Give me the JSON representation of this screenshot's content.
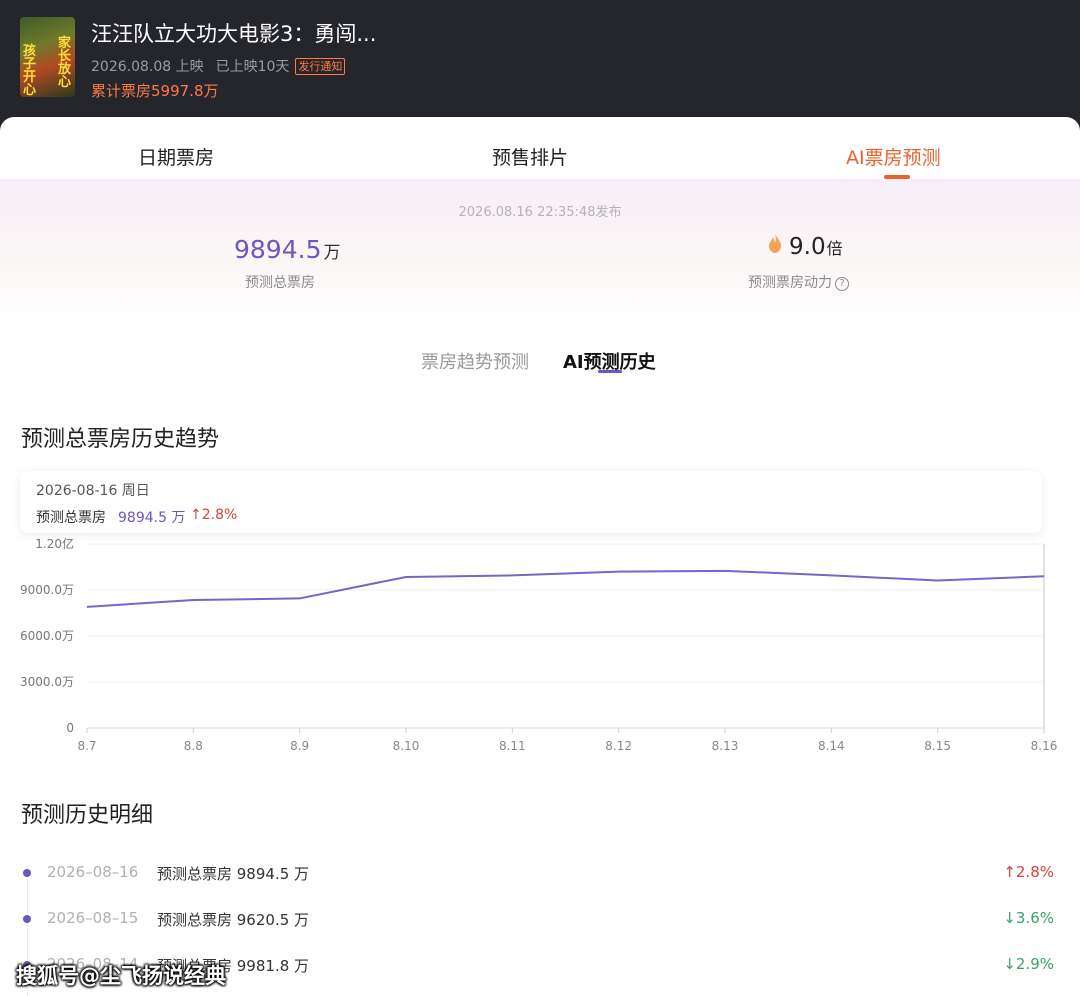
{
  "header": {
    "movie_title": "汪汪队立大功大电影3：勇闯...",
    "poster_left_text": "孩子开心",
    "poster_right_text": "家长放心",
    "release_date": "2026.08.08 上映",
    "days_showing": "已上映10天",
    "notice_badge": "发行通知",
    "cumulative_box_office": "累计票房5997.8万"
  },
  "tabs": [
    {
      "label": "日期票房"
    },
    {
      "label": "预售排片"
    },
    {
      "label": "AI票房预测",
      "active": true
    }
  ],
  "summary": {
    "publish_time": "2026.08.16 22:35:48发布",
    "total_value": "9894.5",
    "total_unit": "万",
    "total_label": "预测总票房",
    "multiplier_value": "9.0",
    "multiplier_unit": "倍",
    "multiplier_label": "预测票房动力",
    "help_glyph": "?"
  },
  "subtabs": [
    {
      "label": "票房趋势预测"
    },
    {
      "label": "AI预测历史",
      "active": true
    }
  ],
  "trend_section_title": "预测总票房历史趋势",
  "tooltip": {
    "date": "2026-08-16  周日",
    "label": "预测总票房",
    "value": "9894.5 万",
    "change": "↑2.8%"
  },
  "chart_data": {
    "type": "line",
    "x": [
      "8.7",
      "8.8",
      "8.9",
      "8.10",
      "8.11",
      "8.12",
      "8.13",
      "8.14",
      "8.15",
      "8.16"
    ],
    "series": [
      {
        "values": [
          7900,
          8350,
          8450,
          9850,
          9950,
          10200,
          10250,
          9950,
          9620.5,
          9894.5
        ]
      }
    ],
    "y_ticks": [
      "0",
      "3000.0万",
      "6000.0万",
      "9000.0万",
      "1.20亿"
    ],
    "ylim": [
      0,
      12000
    ],
    "grid": true,
    "line_color": "#7b63c8"
  },
  "history_section_title": "预测历史明细",
  "history": [
    {
      "date": "2026–08–16",
      "label": "预测总票房 9894.5 万",
      "change": "↑2.8%",
      "dir": "up"
    },
    {
      "date": "2026–08–15",
      "label": "预测总票房 9620.5 万",
      "change": "↓3.6%",
      "dir": "down"
    },
    {
      "date": "2026–08–14",
      "label": "预测总票房 9981.8 万",
      "change": "↓2.9%",
      "dir": "down"
    }
  ],
  "watermark": "搜狐号@尘飞扬说经典",
  "colors": {
    "accent": "#e8622c",
    "purple": "#6e56c0",
    "up": "#d8423a",
    "down": "#3aa36b"
  }
}
